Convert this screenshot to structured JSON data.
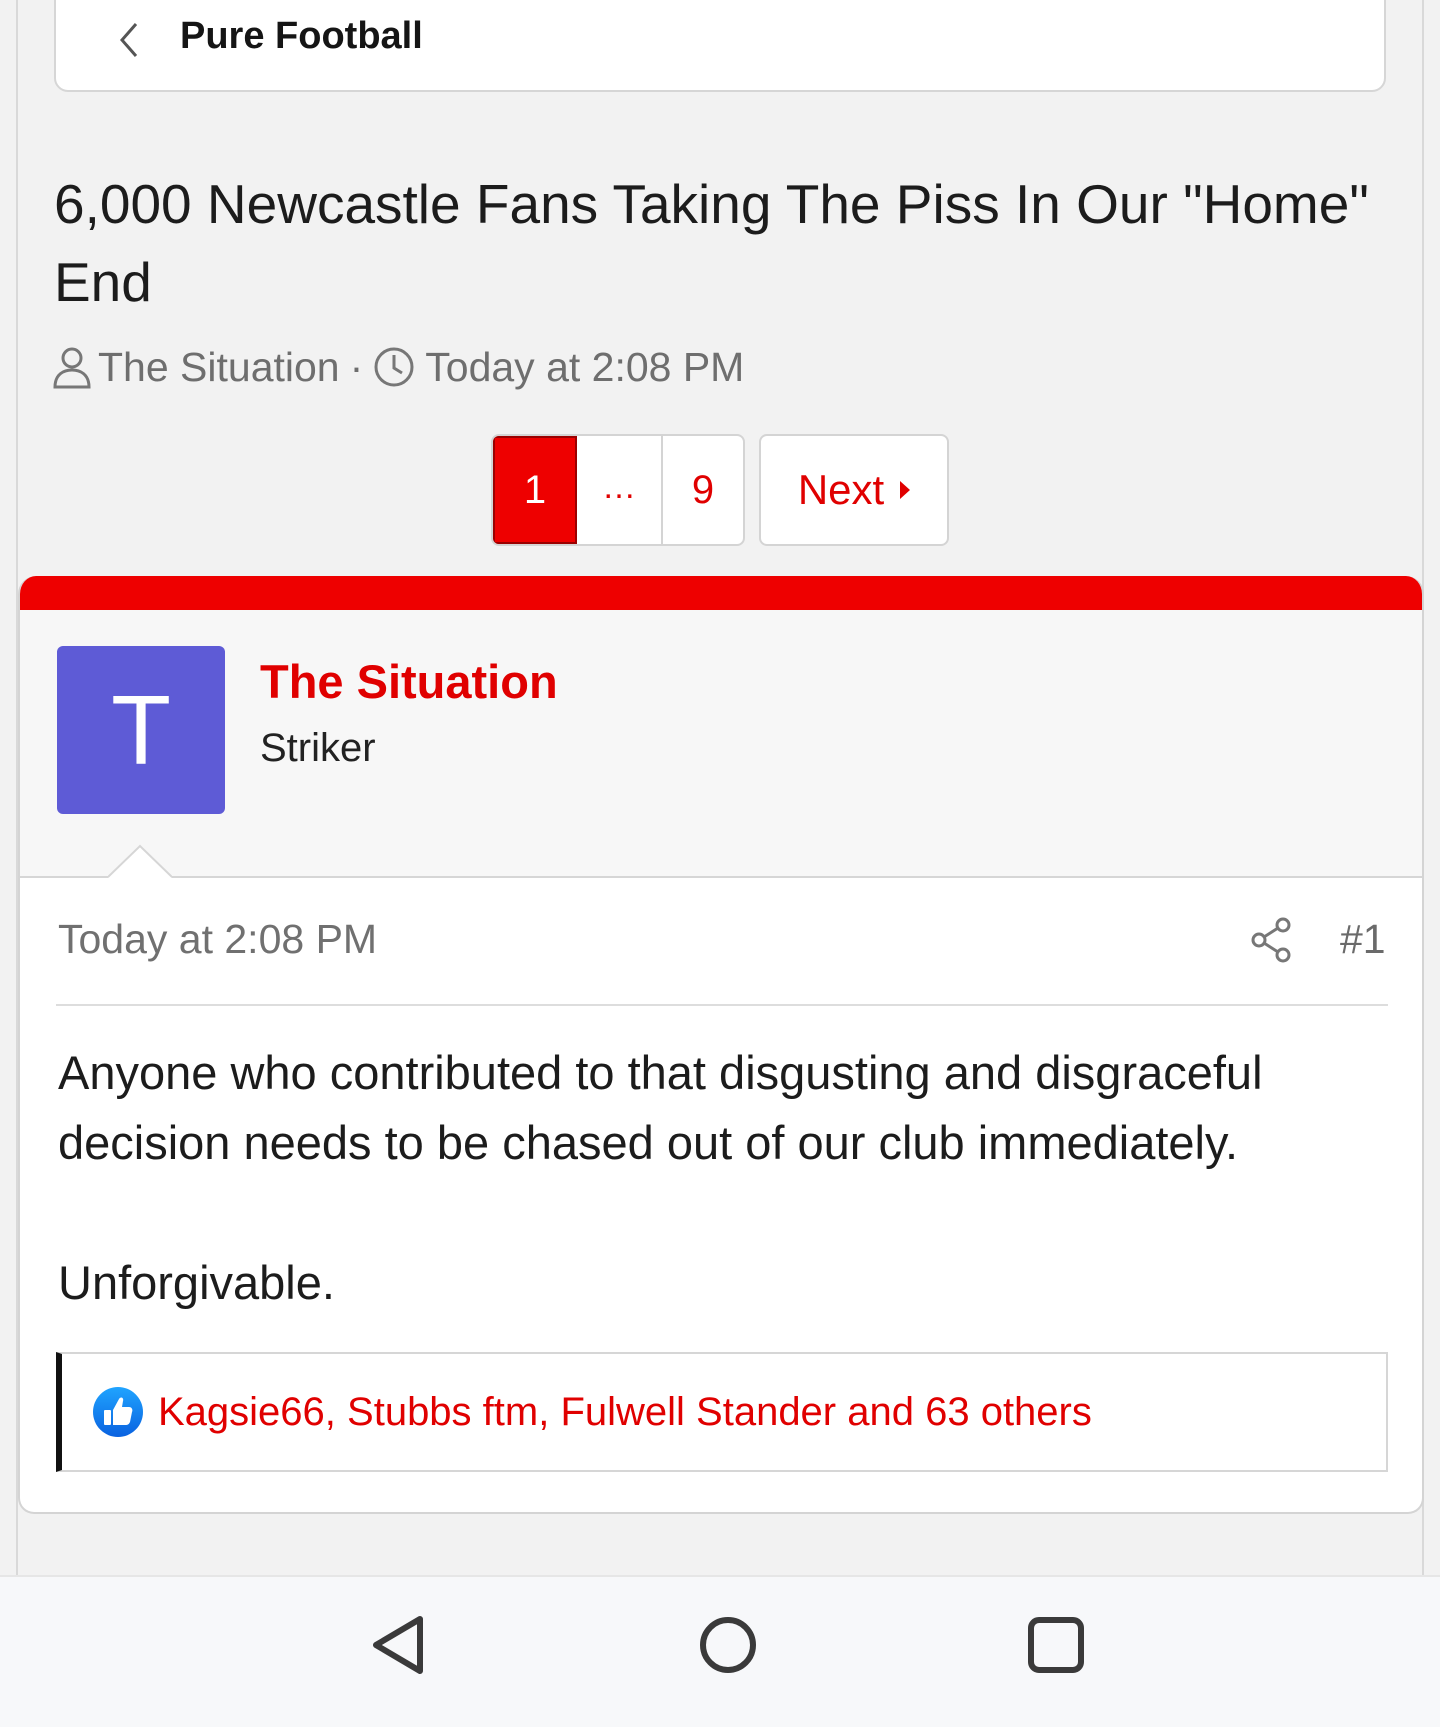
{
  "breadcrumb": {
    "title": "Pure Football"
  },
  "thread": {
    "title": "6,000 Newcastle Fans Taking The Piss In Our \"Home\" End",
    "author": "The Situation",
    "separator": "·",
    "date": "Today at 2:08 PM"
  },
  "pagination": {
    "current": "1",
    "ellipsis": "…",
    "last": "9",
    "next_label": "Next"
  },
  "post": {
    "avatar_letter": "T",
    "username": "The Situation",
    "user_title": "Striker",
    "date": "Today at 2:08 PM",
    "number": "#1",
    "body_line1": "Anyone who contributed to that disgusting and disgraceful decision needs to be chased out of our club immediately.",
    "body_line2": "Unforgivable.",
    "reactions_text": "Kagsie66, Stubbs ftm, Fulwell Stander and 63 others"
  },
  "icons": {
    "back": "chevron-left-icon",
    "user": "user-icon",
    "clock": "clock-icon",
    "share": "share-icon",
    "like": "thumbs-up-icon",
    "nav_back": "triangle-back-icon",
    "nav_home": "circle-home-icon",
    "nav_recents": "square-recents-icon"
  },
  "colors": {
    "accent": "#ee0000",
    "avatar_bg": "#5e5bd6",
    "like_blue": "#1877f2"
  }
}
